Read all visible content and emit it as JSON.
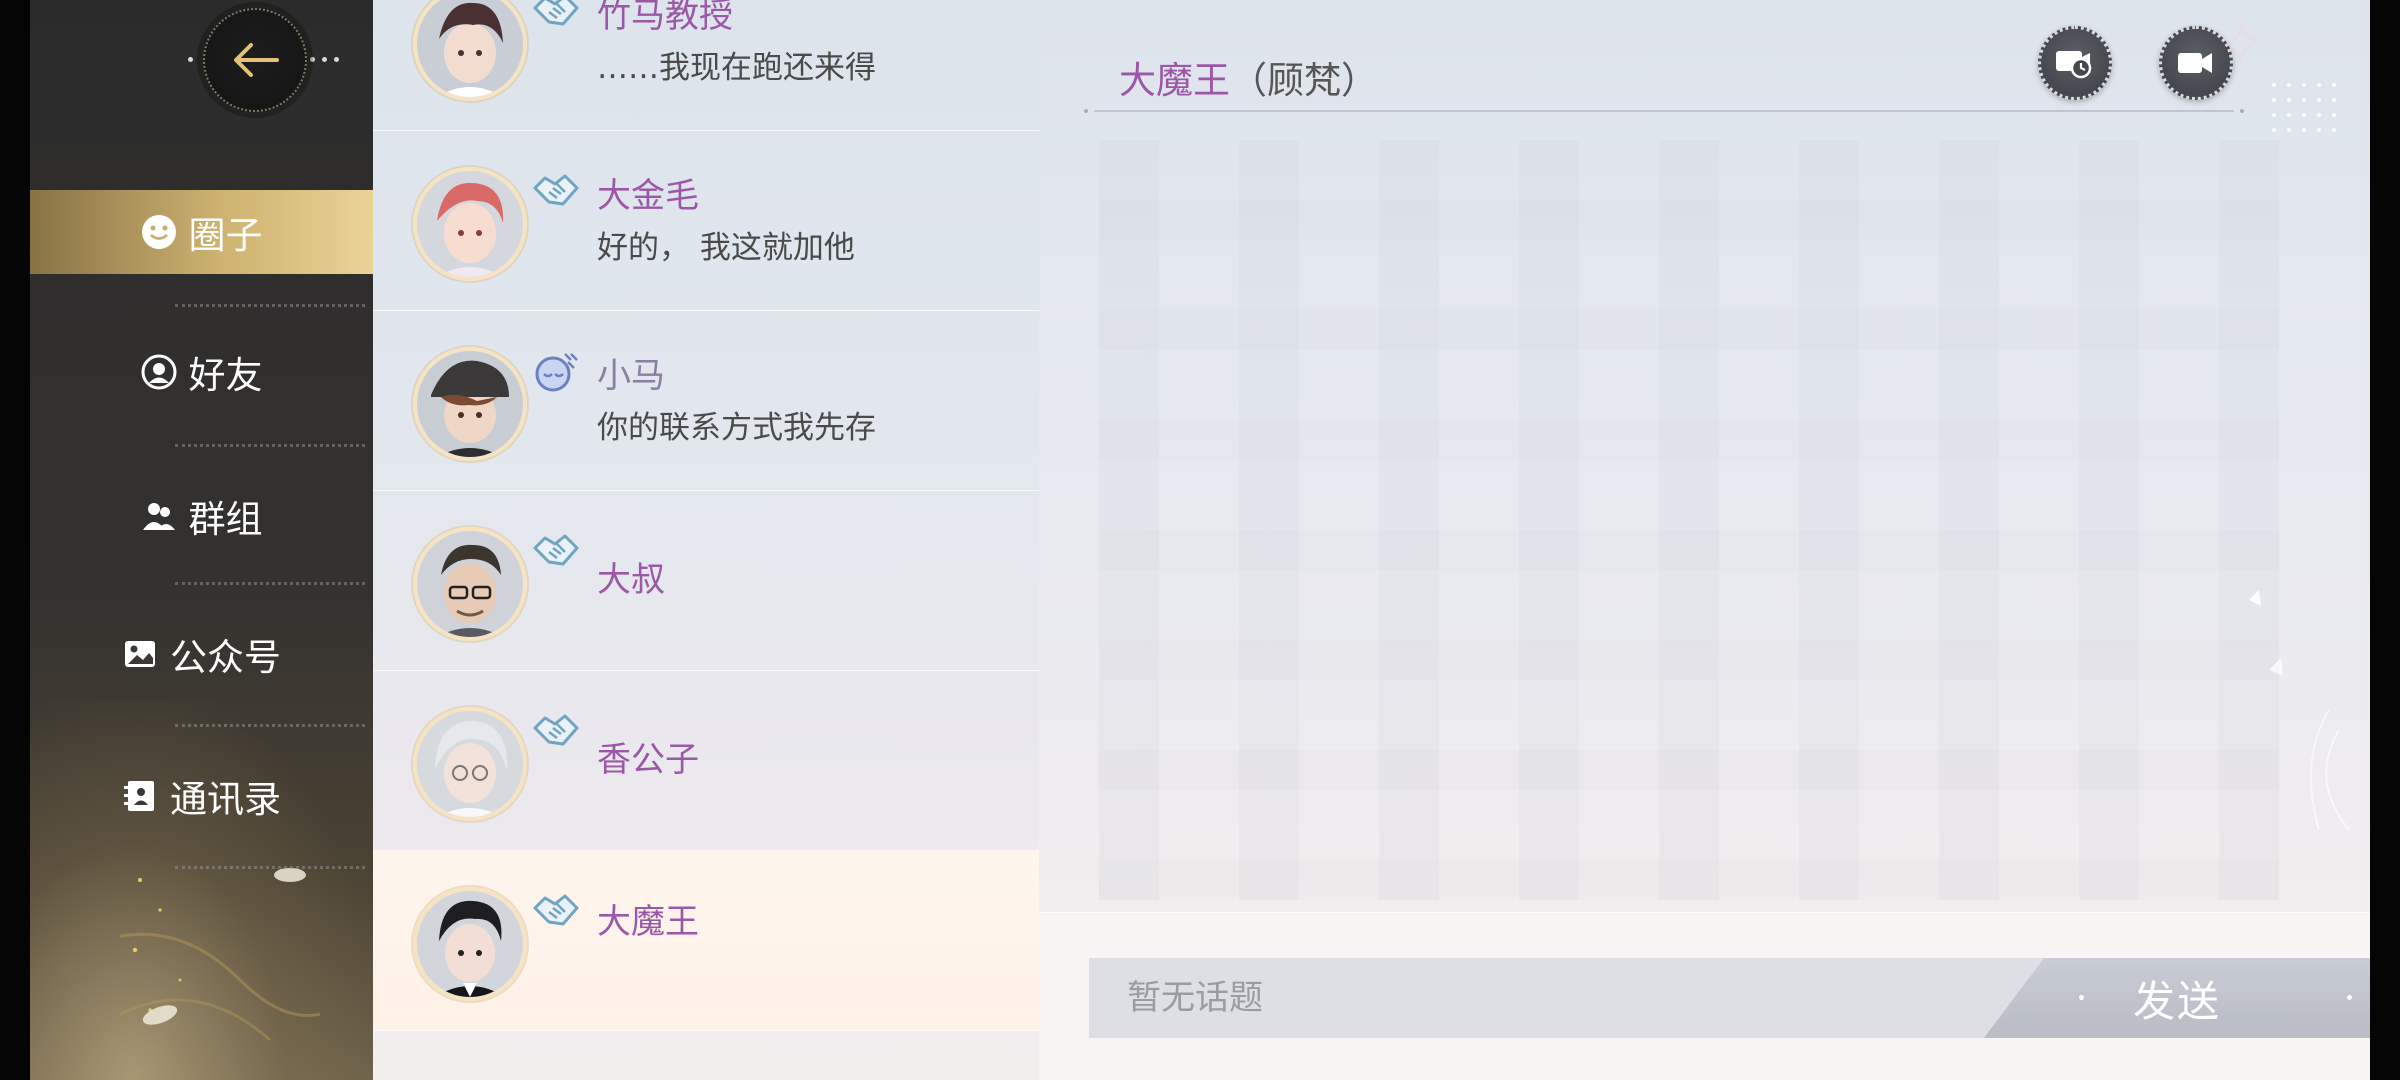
{
  "sidebar": {
    "menu": [
      {
        "label": "圈子",
        "icon": "smiley-icon",
        "active": true
      },
      {
        "label": "好友",
        "icon": "friend-icon",
        "active": false
      },
      {
        "label": "群组",
        "icon": "group-icon",
        "active": false
      },
      {
        "label": "公众号",
        "icon": "picture-icon",
        "active": false
      },
      {
        "label": "通讯录",
        "icon": "contacts-book-icon",
        "active": false
      }
    ],
    "back_icon": "arrow-left-icon"
  },
  "contacts": [
    {
      "name": "竹马教授",
      "message": "……我现在跑还来得",
      "relation_icon": "handshake-icon"
    },
    {
      "name": "大金毛",
      "message": "好的， 我这就加他",
      "relation_icon": "handshake-icon"
    },
    {
      "name": "小马",
      "message": "你的联系方式我先存",
      "relation_icon": "sleepy-face-icon"
    },
    {
      "name": "大叔",
      "message": "",
      "relation_icon": "handshake-icon"
    },
    {
      "name": "香公子",
      "message": "",
      "relation_icon": "handshake-icon"
    },
    {
      "name": "大魔王",
      "message": "",
      "relation_icon": "handshake-icon",
      "selected": true
    }
  ],
  "chat": {
    "title_name": "大魔王",
    "title_real_name": "（顾梵）",
    "schedule_call_icon": "video-schedule-icon",
    "video_call_icon": "video-camera-icon",
    "input_placeholder": "暂无话题",
    "send_label": "发送"
  },
  "colors": {
    "accent_name": "#9b58a7",
    "active_menu": "#cdb270",
    "sidebar_bg": "#2b2b2b"
  }
}
